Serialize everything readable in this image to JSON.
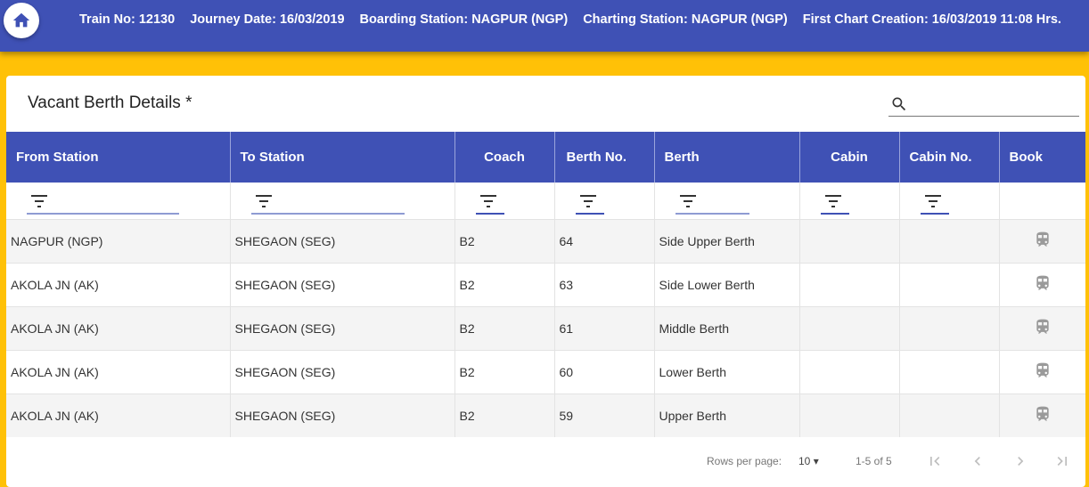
{
  "header": {
    "train_no": "Train No: 12130",
    "journey_date": "Journey Date: 16/03/2019",
    "boarding_station": "Boarding Station: NAGPUR (NGP)",
    "charting_station": "Charting Station: NAGPUR (NGP)",
    "first_chart": "First Chart Creation: 16/03/2019 11:08 Hrs."
  },
  "card": {
    "title": "Vacant Berth Details *",
    "search_placeholder": ""
  },
  "table": {
    "columns": [
      "From Station",
      "To Station",
      "Coach",
      "Berth No.",
      "Berth",
      "Cabin",
      "Cabin No.",
      "Book"
    ],
    "rows": [
      [
        "NAGPUR (NGP)",
        "SHEGAON (SEG)",
        "B2",
        "64",
        "Side Upper Berth",
        "",
        ""
      ],
      [
        "AKOLA JN (AK)",
        "SHEGAON (SEG)",
        "B2",
        "63",
        "Side Lower Berth",
        "",
        ""
      ],
      [
        "AKOLA JN (AK)",
        "SHEGAON (SEG)",
        "B2",
        "61",
        "Middle Berth",
        "",
        ""
      ],
      [
        "AKOLA JN (AK)",
        "SHEGAON (SEG)",
        "B2",
        "60",
        "Lower Berth",
        "",
        ""
      ],
      [
        "AKOLA JN (AK)",
        "SHEGAON (SEG)",
        "B2",
        "59",
        "Upper Berth",
        "",
        ""
      ]
    ]
  },
  "pagination": {
    "rows_per_page_label": "Rows per page:",
    "rows_per_page": "10",
    "range": "1-5 of 5"
  },
  "icons": {
    "home": "home-icon",
    "search": "search-icon",
    "filter": "filter-icon",
    "book": "train-icon"
  },
  "colors": {
    "header": "#3f51b5",
    "background": "#ffc107"
  }
}
